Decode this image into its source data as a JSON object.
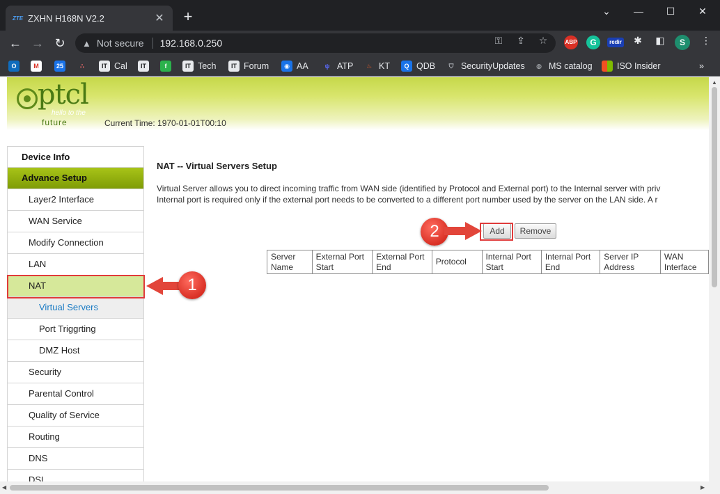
{
  "browser": {
    "tab_title": "ZXHN H168N V2.2",
    "tab_favicon": "ZTE",
    "not_secure": "Not secure",
    "url": "192.168.0.250",
    "profile_initial": "S",
    "ext_abp": "ABP",
    "ext_redir": "redir"
  },
  "bookmarks": [
    {
      "label": "Cal"
    },
    {
      "label": "Tech"
    },
    {
      "label": "Forum"
    },
    {
      "label": "AA"
    },
    {
      "label": "ATP"
    },
    {
      "label": "KT"
    },
    {
      "label": "QDB"
    },
    {
      "label": "SecurityUpdates"
    },
    {
      "label": "MS catalog"
    },
    {
      "label": "ISO Insider"
    }
  ],
  "header": {
    "logo_text": "ptcl",
    "logo_tagline": "hello to the",
    "logo_sub": "future",
    "current_time": "Current Time: 1970-01-01T00:10"
  },
  "menu": {
    "device_info": "Device Info",
    "advance_setup": "Advance Setup",
    "layer2": "Layer2 Interface",
    "wan_service": "WAN Service",
    "modify_connection": "Modify Connection",
    "lan": "LAN",
    "nat": "NAT",
    "virtual_servers": "Virtual Servers",
    "port_triggering": "Port Triggrting",
    "dmz_host": "DMZ Host",
    "security": "Security",
    "parental_control": "Parental Control",
    "qos": "Quality of Service",
    "routing": "Routing",
    "dns": "DNS",
    "dsl": "DSL"
  },
  "main": {
    "title": "NAT -- Virtual Servers Setup",
    "desc_line1": "Virtual Server allows you to direct incoming traffic from WAN side (identified by Protocol and External port) to the Internal server with priv",
    "desc_line2": "Internal port is required only if the external port needs to be converted to a different port number used by the server on the LAN side. A r",
    "add_label": "Add",
    "remove_label": "Remove",
    "table_headers": [
      [
        "Server",
        "Name"
      ],
      [
        "External Port",
        "Start"
      ],
      [
        "External Port",
        "End"
      ],
      [
        "Protocol",
        ""
      ],
      [
        "Internal Port",
        "Start"
      ],
      [
        "Internal Port",
        "End"
      ],
      [
        "Server IP",
        "Address"
      ],
      [
        "WAN",
        "Interface"
      ]
    ]
  },
  "annotations": {
    "step1": "1",
    "step2": "2"
  },
  "colors": {
    "callout_red": "#d93025",
    "menu_green": "#7f9c06",
    "active_link": "#1a7bc4"
  }
}
